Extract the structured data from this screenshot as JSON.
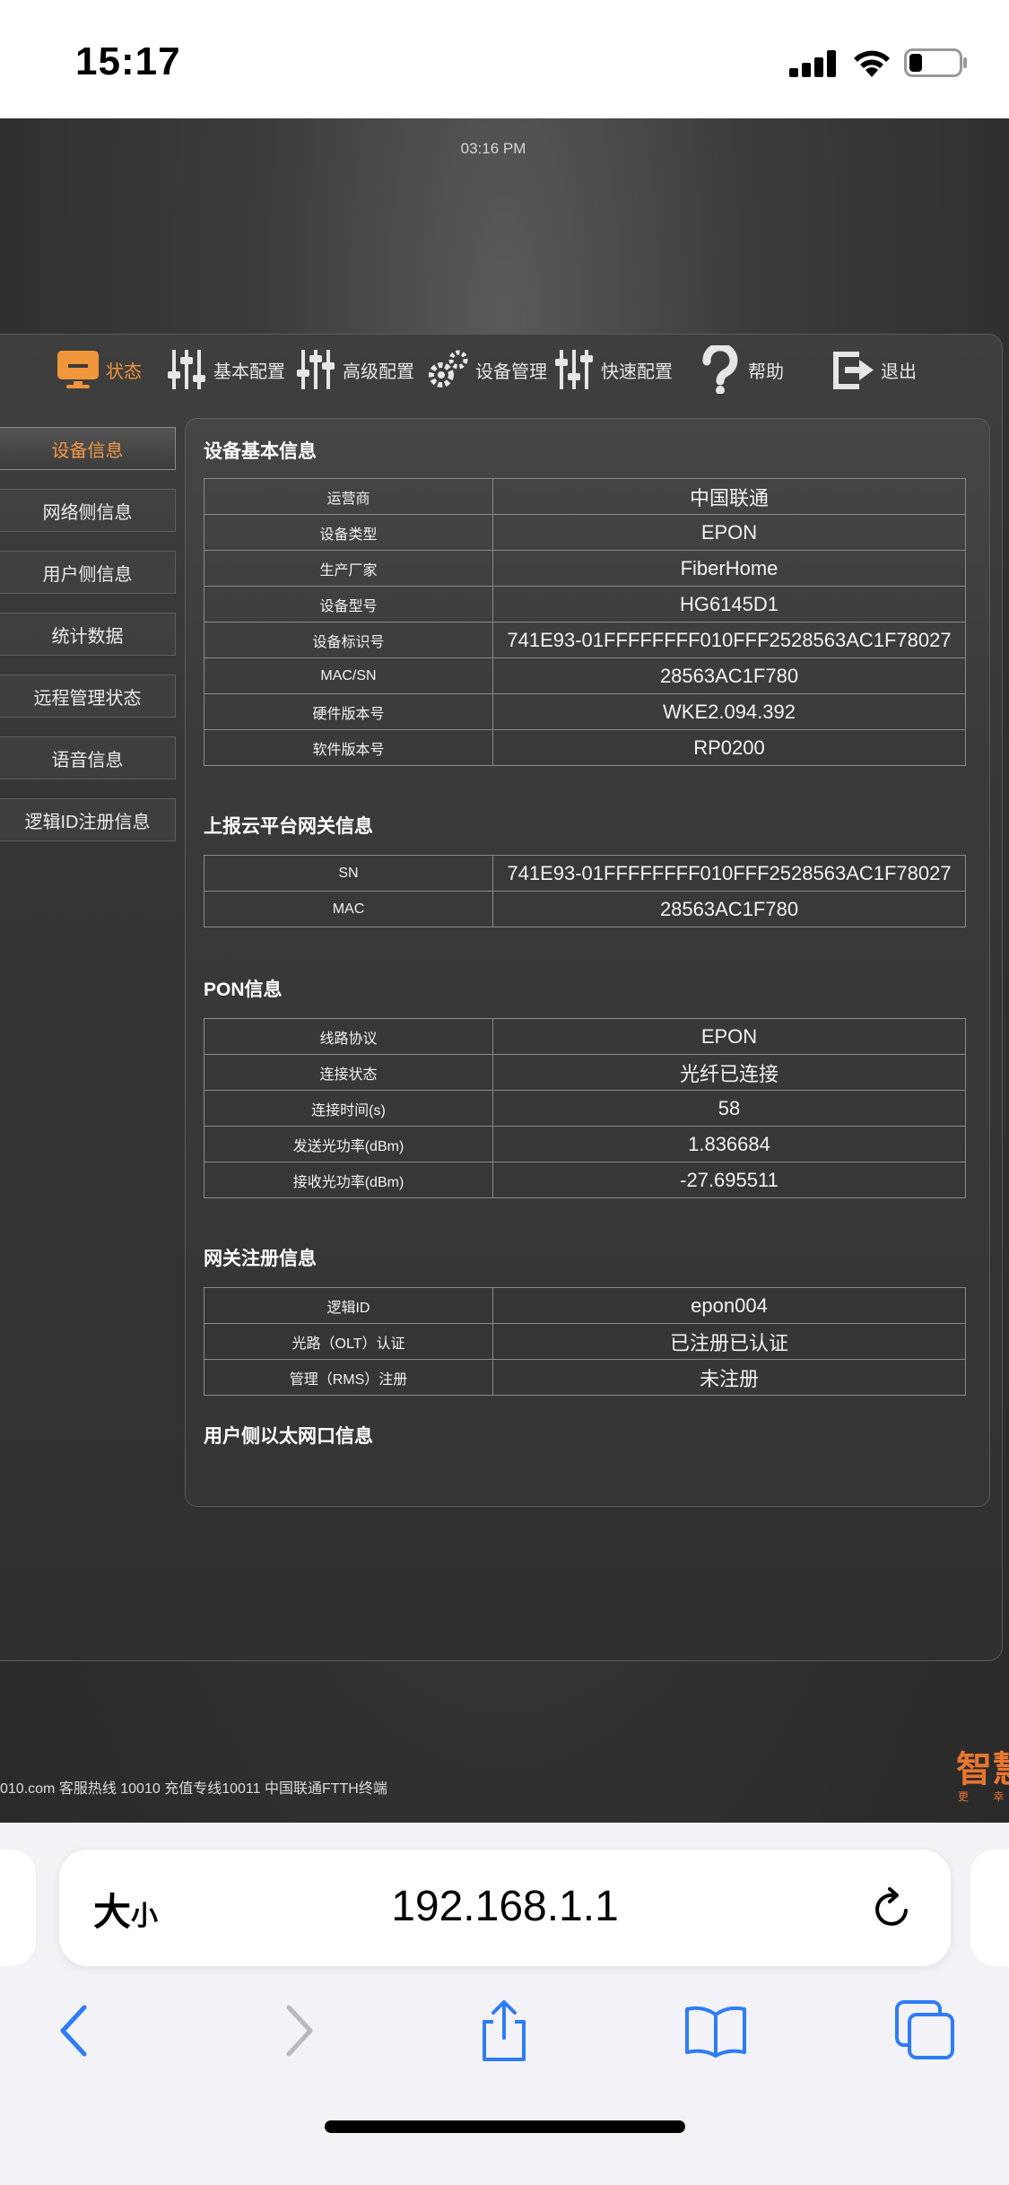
{
  "status_bar": {
    "time": "15:17"
  },
  "page": {
    "clock": "03:16 PM",
    "nav": [
      {
        "label": "状态",
        "icon": "monitor-icon",
        "active": true
      },
      {
        "label": "基本配置",
        "icon": "sliders-icon"
      },
      {
        "label": "高级配置",
        "icon": "sliders-advanced-icon"
      },
      {
        "label": "设备管理",
        "icon": "gears-icon"
      },
      {
        "label": "快速配置",
        "icon": "sliders-quick-icon"
      },
      {
        "label": "帮助",
        "icon": "help-icon"
      },
      {
        "label": "退出",
        "icon": "logout-icon"
      }
    ],
    "sidebar": [
      {
        "label": "设备信息",
        "active": true
      },
      {
        "label": "网络侧信息"
      },
      {
        "label": "用户侧信息"
      },
      {
        "label": "统计数据"
      },
      {
        "label": "远程管理状态"
      },
      {
        "label": "语音信息"
      },
      {
        "label": "逻辑ID注册信息"
      }
    ],
    "sections": {
      "basic": {
        "title": "设备基本信息",
        "rows": [
          [
            "运营商",
            "中国联通"
          ],
          [
            "设备类型",
            "EPON"
          ],
          [
            "生产厂家",
            "FiberHome"
          ],
          [
            "设备型号",
            "HG6145D1"
          ],
          [
            "设备标识号",
            "741E93-01FFFFFFFF010FFF2528563AC1F78027"
          ],
          [
            "MAC/SN",
            "28563AC1F780"
          ],
          [
            "硬件版本号",
            "WKE2.094.392"
          ],
          [
            "软件版本号",
            "RP0200"
          ]
        ]
      },
      "cloud": {
        "title": "上报云平台网关信息",
        "rows": [
          [
            "SN",
            "741E93-01FFFFFFFF010FFF2528563AC1F78027"
          ],
          [
            "MAC",
            "28563AC1F780"
          ]
        ]
      },
      "pon": {
        "title": "PON信息",
        "rows": [
          [
            "线路协议",
            "EPON"
          ],
          [
            "连接状态",
            "光纤已连接"
          ],
          [
            "连接时间(s)",
            "58"
          ],
          [
            "发送光功率(dBm)",
            "1.836684"
          ],
          [
            "接收光功率(dBm)",
            "-27.695511"
          ]
        ]
      },
      "gateway": {
        "title": "网关注册信息",
        "rows": [
          [
            "逻辑ID",
            "epon004"
          ],
          [
            "光路（OLT）认证",
            "已注册已认证"
          ],
          [
            "管理（RMS）注册",
            "未注册"
          ]
        ]
      },
      "ethernet": {
        "title": "用户侧以太网口信息"
      }
    },
    "footer": "010.com 客服热线 10010 充值专线10011 中国联通FTTH终端",
    "brand": "智慧",
    "brand_sub": "更 幸"
  },
  "safari": {
    "text_size_label": "大",
    "text_size_small": "小",
    "url": "192.168.1.1"
  },
  "colors": {
    "accent": "#f0963c",
    "ios_blue": "#2f7cf6"
  }
}
